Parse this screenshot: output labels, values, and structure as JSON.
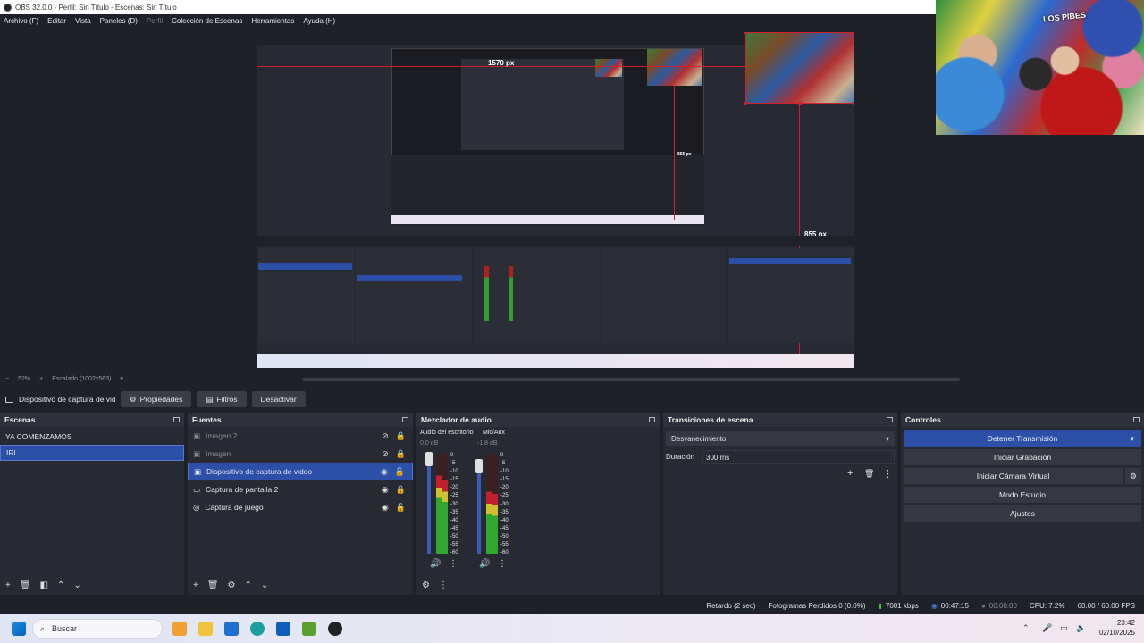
{
  "window": {
    "title": "OBS 32.0.0 - Perfil: Sin Título - Escenas: Sin Título"
  },
  "menu": [
    {
      "label": "Archivo (F)",
      "enabled": true
    },
    {
      "label": "Editar",
      "enabled": true
    },
    {
      "label": "Vista",
      "enabled": true
    },
    {
      "label": "Paneles (D)",
      "enabled": true
    },
    {
      "label": "Perfil",
      "enabled": false
    },
    {
      "label": "Colección de Escenas",
      "enabled": true
    },
    {
      "label": "Herramientas",
      "enabled": true
    },
    {
      "label": "Ayuda (H)",
      "enabled": true
    }
  ],
  "preview": {
    "measure_top": "1570 px",
    "measure_right": "855 px",
    "measure_small": "855 px",
    "overlay_text": "LOS PIBES"
  },
  "zoom": {
    "minus": "−",
    "percent": "52%",
    "plus": "+",
    "scale": "Escalado (1002x563)",
    "dropdown": "▾"
  },
  "source_toolbar": {
    "selected_source": "Dispositivo de captura de video",
    "properties": "Propiedades",
    "filters": "Filtros",
    "deactivate": "Desactivar"
  },
  "scenes": {
    "title": "Escenas",
    "items": [
      {
        "label": "YA COMENZAMOS",
        "selected": false
      },
      {
        "label": "IRL",
        "selected": true
      }
    ]
  },
  "sources": {
    "title": "Fuentes",
    "items": [
      {
        "label": "Imagen 2",
        "icon": "image-icon",
        "visible": false,
        "locked": true,
        "dim": true
      },
      {
        "label": "Imagen",
        "icon": "image-icon",
        "visible": false,
        "locked": true,
        "dim": true
      },
      {
        "label": "Dispositivo de captura de video",
        "icon": "camera-icon",
        "visible": true,
        "locked": false,
        "selected": true
      },
      {
        "label": "Captura de pantalla 2",
        "icon": "monitor-icon",
        "visible": true,
        "locked": true
      },
      {
        "label": "Captura de juego",
        "icon": "gamepad-icon",
        "visible": true,
        "locked": false
      }
    ]
  },
  "mixer": {
    "title": "Mezclador de audio",
    "channels": [
      {
        "name": "Audio del escritorio",
        "db": "0.0 dB",
        "level": 0.78
      },
      {
        "name": "Mic/Aux",
        "db": "-1.8 dB",
        "level": 0.62
      }
    ],
    "scale": [
      "0",
      "-5",
      "-10",
      "-15",
      "-20",
      "-25",
      "-30",
      "-35",
      "-40",
      "-45",
      "-50",
      "-55",
      "-60"
    ]
  },
  "transitions": {
    "title": "Transiciones de escena",
    "selected": "Desvanecimiento",
    "duration_label": "Duración",
    "duration_value": "300 ms"
  },
  "controls": {
    "title": "Controles",
    "buttons": [
      "Detener Transmisión",
      "Iniciar Grabación",
      "Iniciar Cámara Virtual",
      "Modo Estudio",
      "Ajustes"
    ]
  },
  "status": {
    "delay": "Retardo (2 sec)",
    "dropped": "Fotogramas Perdidos 0 (0.0%)",
    "bitrate": "7081 kbps",
    "stream_time": "00:47:15",
    "rec_time": "00:00:00",
    "cpu": "CPU: 7.2%",
    "fps": "60.00 / 60.00 FPS"
  },
  "taskbar": {
    "search_placeholder": "Buscar",
    "time": "23:42",
    "date": "02/10/2025"
  },
  "colors": {
    "accent": "#2c4fa8",
    "guide": "#d0202a",
    "panel": "#272a33",
    "background": "#1f2128"
  }
}
